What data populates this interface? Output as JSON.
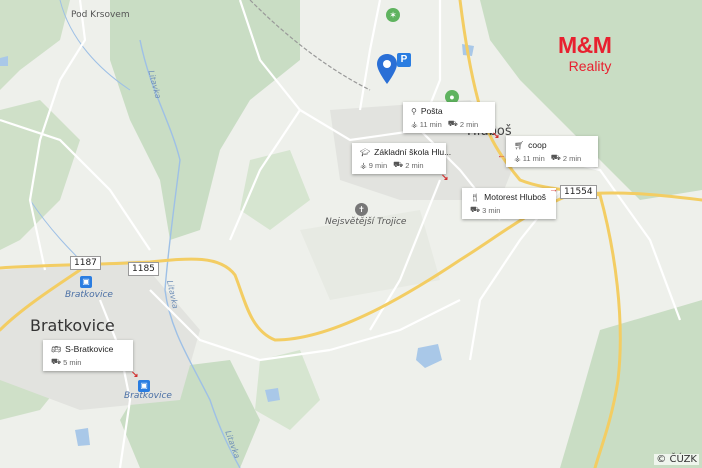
{
  "map": {
    "colors": {
      "background": "#eef0eb",
      "forest": "#c9ddc4",
      "road_major": "#f3cd63",
      "road_minor": "#ffffff",
      "water": "#a9c8e8",
      "accent": "#e8202f"
    }
  },
  "labels": {
    "pod_krsovem": "Pod Krsovem",
    "bratkovice_town": "Bratkovice",
    "bratkovice_station": "Bratkovice",
    "bratkovice_station2": "Bratkovice",
    "hluboš": "Hluboš",
    "nejsvetejsi": "Nejsvětější Trojice",
    "river1": "Litavka",
    "river2": "Litavka",
    "river3": "Litavka"
  },
  "roads": {
    "r1187": "1187",
    "r1185": "1185",
    "r11554": "11554"
  },
  "pois": [
    {
      "title": "Pošta",
      "icon": "sitemap-icon",
      "walk": "11 min",
      "car": "2 min"
    },
    {
      "title": "Základní škola Hlu...",
      "icon": "school-icon",
      "walk": "9 min",
      "car": "2 min"
    },
    {
      "title": "coop",
      "icon": "cart-icon",
      "walk": "11 min",
      "car": "2 min"
    },
    {
      "title": "Motorest Hluboš",
      "icon": "restaurant-icon",
      "car": "3 min"
    },
    {
      "title": "S-Bratkovice",
      "icon": "bus-icon",
      "car": "5 min"
    }
  ],
  "brand": {
    "name": "M&M",
    "sub": "Reality"
  },
  "copyright": "© ČÚZK"
}
